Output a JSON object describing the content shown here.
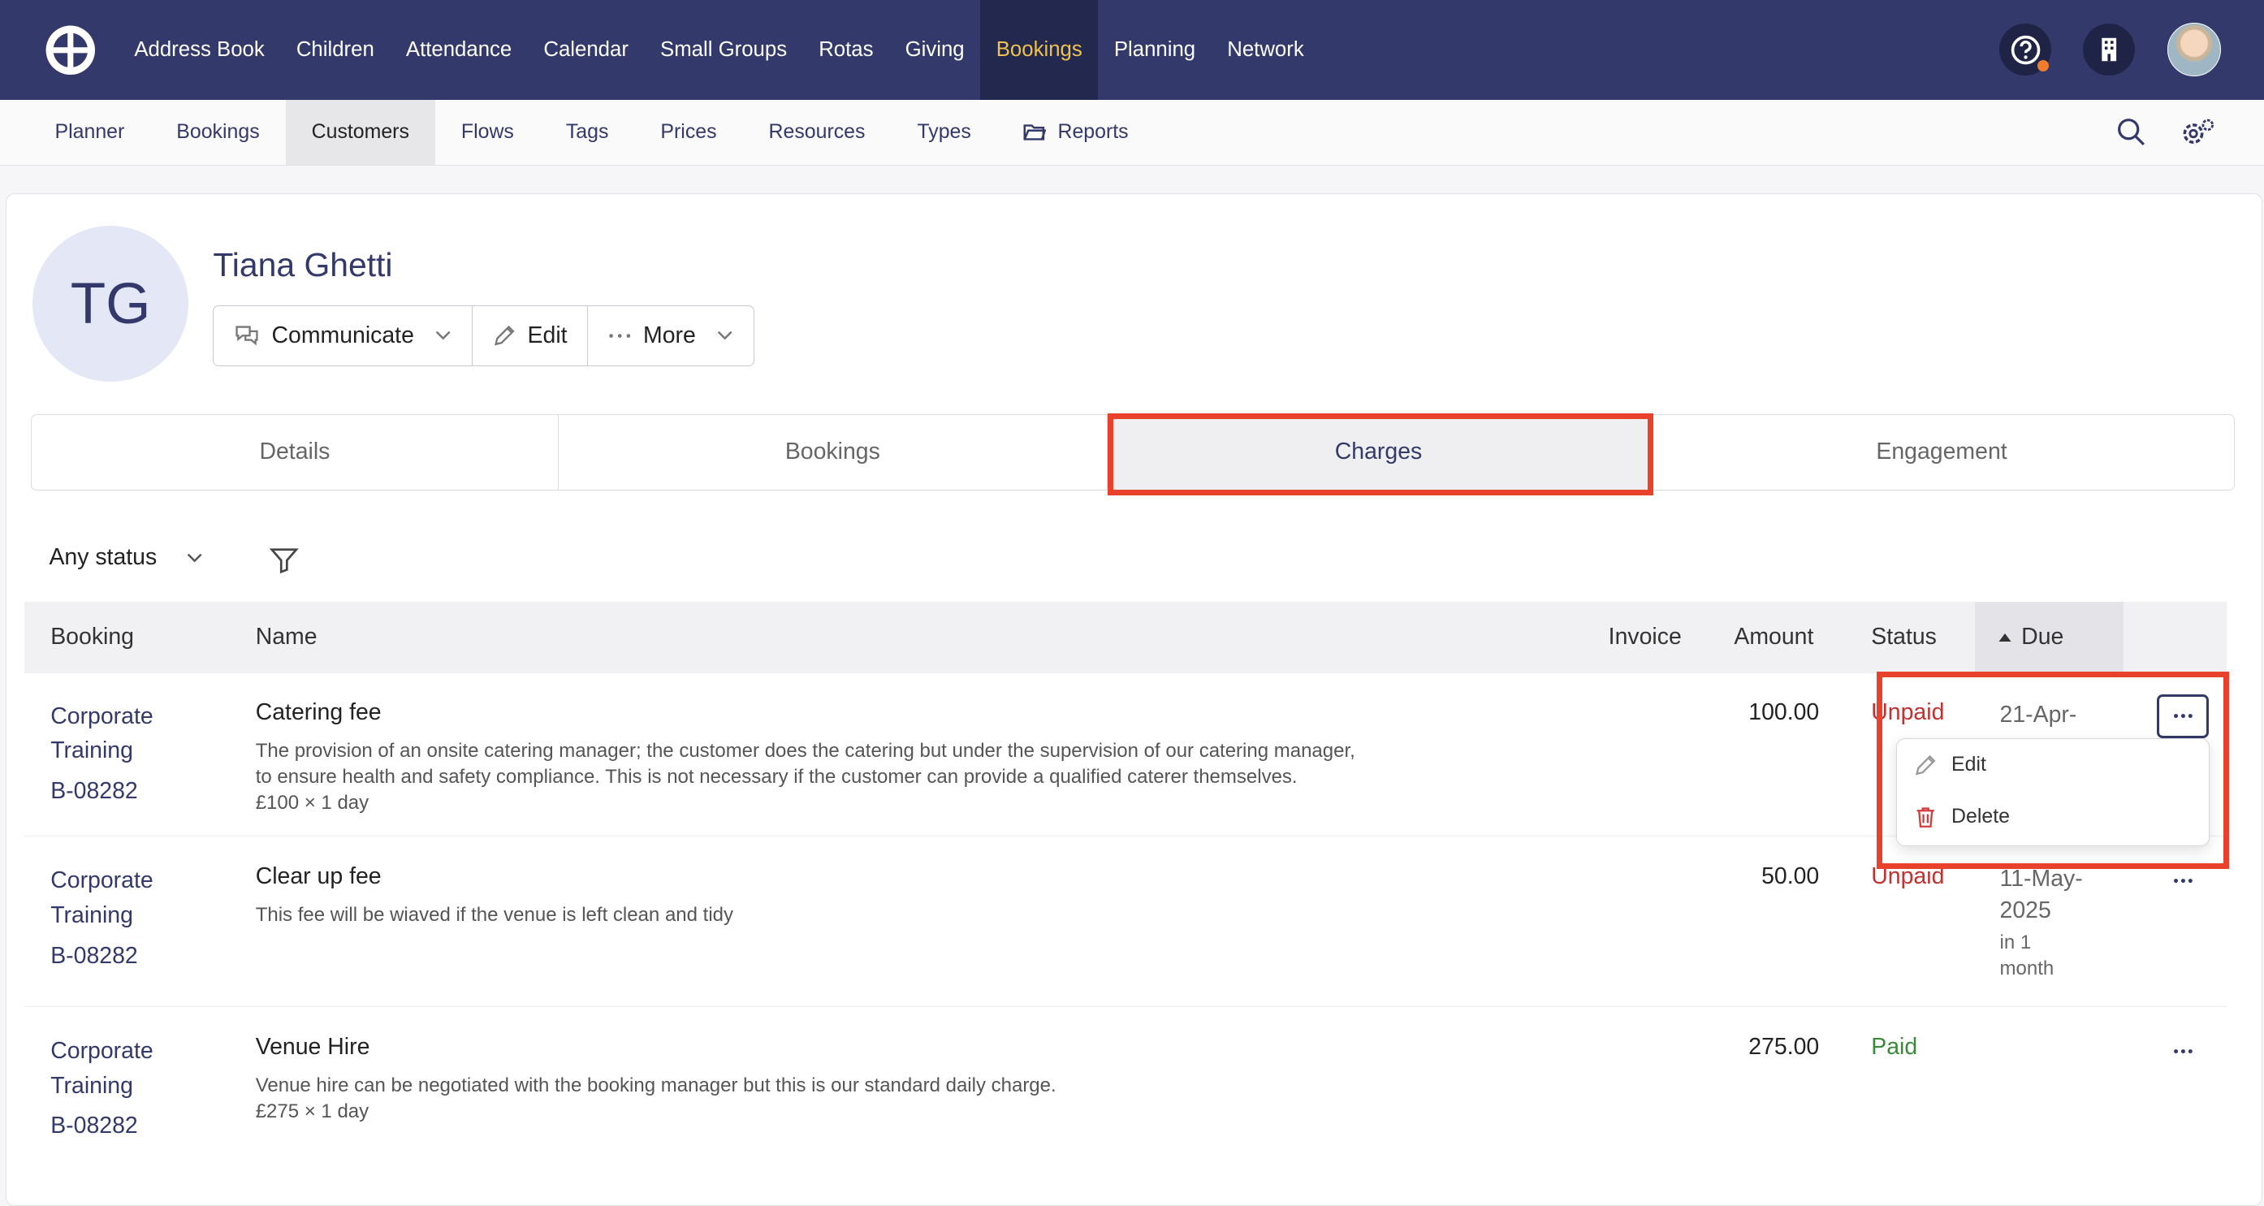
{
  "topnav": {
    "items": [
      "Address Book",
      "Children",
      "Attendance",
      "Calendar",
      "Small Groups",
      "Rotas",
      "Giving",
      "Bookings",
      "Planning",
      "Network"
    ],
    "active_index": 7,
    "accent_color": "#f0c24b",
    "icons": [
      "help-icon",
      "building-icon",
      "user-avatar"
    ]
  },
  "subnav": {
    "items": [
      "Planner",
      "Bookings",
      "Customers",
      "Flows",
      "Tags",
      "Prices",
      "Resources",
      "Types",
      "Reports"
    ],
    "active_index": 2,
    "icons": [
      "search-icon",
      "settings-gear-icon"
    ]
  },
  "customer": {
    "initials": "TG",
    "name": "Tiana Ghetti",
    "actions": {
      "communicate": "Communicate",
      "edit": "Edit",
      "more": "More"
    }
  },
  "tabs": [
    "Details",
    "Bookings",
    "Charges",
    "Engagement"
  ],
  "active_tab": 2,
  "filter": {
    "status_label": "Any status"
  },
  "table": {
    "columns": {
      "booking": "Booking",
      "name": "Name",
      "invoice": "Invoice",
      "amount": "Amount",
      "status": "Status",
      "due": "Due"
    },
    "rows": [
      {
        "booking_line1": "Corporate",
        "booking_line2": "Training",
        "booking_ref": "B-08282",
        "name": "Catering fee",
        "desc1": "The provision of an onsite catering manager; the customer does the catering but under the supervision of our catering manager,",
        "desc2": "to ensure health and safety compliance. This is not necessary if the customer can provide a qualified caterer themselves.",
        "desc3": "£100 × 1 day",
        "amount": "100.00",
        "status": "Unpaid",
        "due": "21-Apr-",
        "due_note": ""
      },
      {
        "booking_line1": "Corporate",
        "booking_line2": "Training",
        "booking_ref": "B-08282",
        "name": "Clear up fee",
        "desc1": "This fee will be wiaved if the venue is left clean and tidy",
        "desc2": "",
        "desc3": "",
        "amount": "50.00",
        "status": "Unpaid",
        "due": "11-May-",
        "due2": "2025",
        "due_note1": "in 1",
        "due_note2": "month"
      },
      {
        "booking_line1": "Corporate",
        "booking_line2": "Training",
        "booking_ref": "B-08282",
        "name": "Venue Hire",
        "desc1": "Venue hire can be negotiated with the booking manager but this is our standard daily charge.",
        "desc2": "£275 × 1 day",
        "desc3": "",
        "amount": "275.00",
        "status": "Paid",
        "due": "",
        "due_note": ""
      }
    ]
  },
  "row_menu": {
    "edit": "Edit",
    "delete": "Delete"
  },
  "colors": {
    "primary": "#33396a",
    "highlight": "#e8412c",
    "unpaid": "#c43030",
    "paid": "#3a8a3a"
  }
}
